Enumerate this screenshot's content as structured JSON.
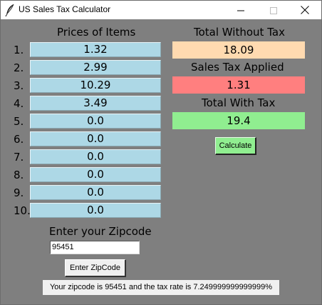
{
  "window": {
    "title": "US Sales Tax Calculator",
    "icon": "feather-icon",
    "controls": {
      "minimize": "minimize-icon",
      "maximize": "maximize-icon",
      "close": "close-icon"
    }
  },
  "prices": {
    "header": "Prices of Items",
    "items": [
      {
        "index": "1.",
        "value": "1.32"
      },
      {
        "index": "2.",
        "value": "2.99"
      },
      {
        "index": "3.",
        "value": "10.29"
      },
      {
        "index": "4.",
        "value": "3.49"
      },
      {
        "index": "5.",
        "value": "0.0"
      },
      {
        "index": "6.",
        "value": "0.0"
      },
      {
        "index": "7.",
        "value": "0.0"
      },
      {
        "index": "8.",
        "value": "0.0"
      },
      {
        "index": "9.",
        "value": "0.0"
      },
      {
        "index": "10.",
        "value": "0.0"
      }
    ],
    "field_color": "#add8e6"
  },
  "totals": {
    "without_tax_label": "Total Without Tax",
    "without_tax_value": "18.09",
    "without_tax_color": "#ffdab0",
    "tax_applied_label": "Sales Tax Applied",
    "tax_applied_value": "1.31",
    "tax_applied_color": "#ff7f7f",
    "with_tax_label": "Total With Tax",
    "with_tax_value": "19.4",
    "with_tax_color": "#90ee90"
  },
  "calculate_button": {
    "label": "Calculate",
    "color": "#90ee90"
  },
  "zipcode": {
    "label": "Enter your Zipcode",
    "value": "95451",
    "button_label": "Enter ZipCode",
    "result_text": "Your zipcode is 95451 and the tax rate is 7.249999999999999%"
  },
  "background_color": "#7f7f7f"
}
